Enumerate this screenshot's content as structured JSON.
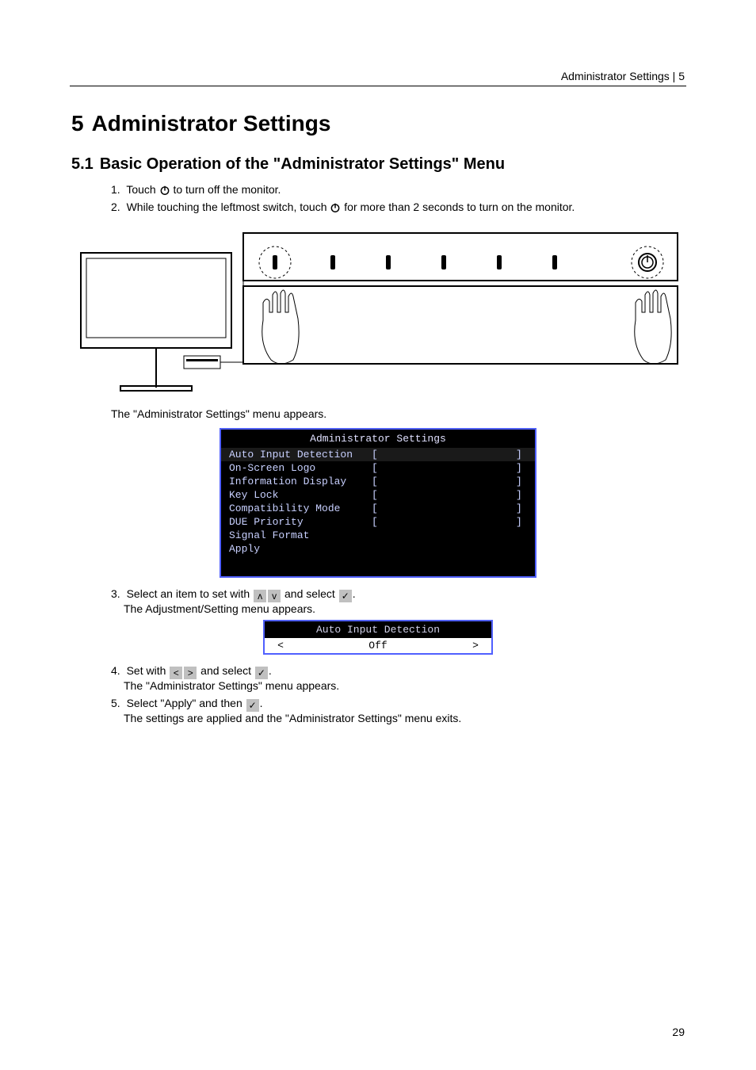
{
  "header": {
    "text": "Administrator Settings  |  5"
  },
  "chapter": {
    "number": "5",
    "title": "Administrator Settings"
  },
  "section": {
    "number": "5.1",
    "title": "Basic Operation of the \"Administrator Settings\" Menu"
  },
  "steps": {
    "s1_prefix": "1.",
    "s1_a": "Touch ",
    "s1_b": " to turn off the monitor.",
    "s2_prefix": "2.",
    "s2_a": "While touching the leftmost switch, touch ",
    "s2_b": " for more than 2 seconds to turn on the monitor.",
    "figcap": "The \"Administrator Settings\" menu appears.",
    "s3_prefix": "3.",
    "s3_a": "Select an item to set with ",
    "s3_b": " and select ",
    "s3_c": ".",
    "s3_sub": "The Adjustment/Setting menu appears.",
    "s4_prefix": "4.",
    "s4_a": "Set with ",
    "s4_b": " and select ",
    "s4_c": ".",
    "s4_sub": "The \"Administrator Settings\" menu appears.",
    "s5_prefix": "5.",
    "s5_a": "Select \"Apply\" and then ",
    "s5_b": ".",
    "s5_sub": "The settings are applied and the \"Administrator Settings\" menu exits."
  },
  "menu": {
    "title": "Administrator Settings",
    "rows": [
      {
        "label": "Auto Input Detection",
        "left": "[",
        "value": "",
        "right": "]"
      },
      {
        "label": "On-Screen Logo",
        "left": "[",
        "value": "",
        "right": "]"
      },
      {
        "label": "Information Display",
        "left": "[",
        "value": "",
        "right": "]"
      },
      {
        "label": "Key Lock",
        "left": "[",
        "value": "",
        "right": "]"
      },
      {
        "label": "Compatibility Mode",
        "left": "[",
        "value": "",
        "right": "]"
      },
      {
        "label": "DUE Priority",
        "left": "[",
        "value": "",
        "right": "]"
      },
      {
        "label": "Signal Format",
        "left": "",
        "value": "",
        "right": ""
      },
      {
        "label": "Apply",
        "left": "",
        "value": "",
        "right": ""
      }
    ]
  },
  "submenu": {
    "title": "Auto Input Detection",
    "left_arrow": "<",
    "value": "Off",
    "right_arrow": ">"
  },
  "buttons": {
    "up": "ᴧ",
    "down": "ᴠ",
    "check": "✓",
    "left": "<",
    "right": ">"
  },
  "page_number": "29"
}
